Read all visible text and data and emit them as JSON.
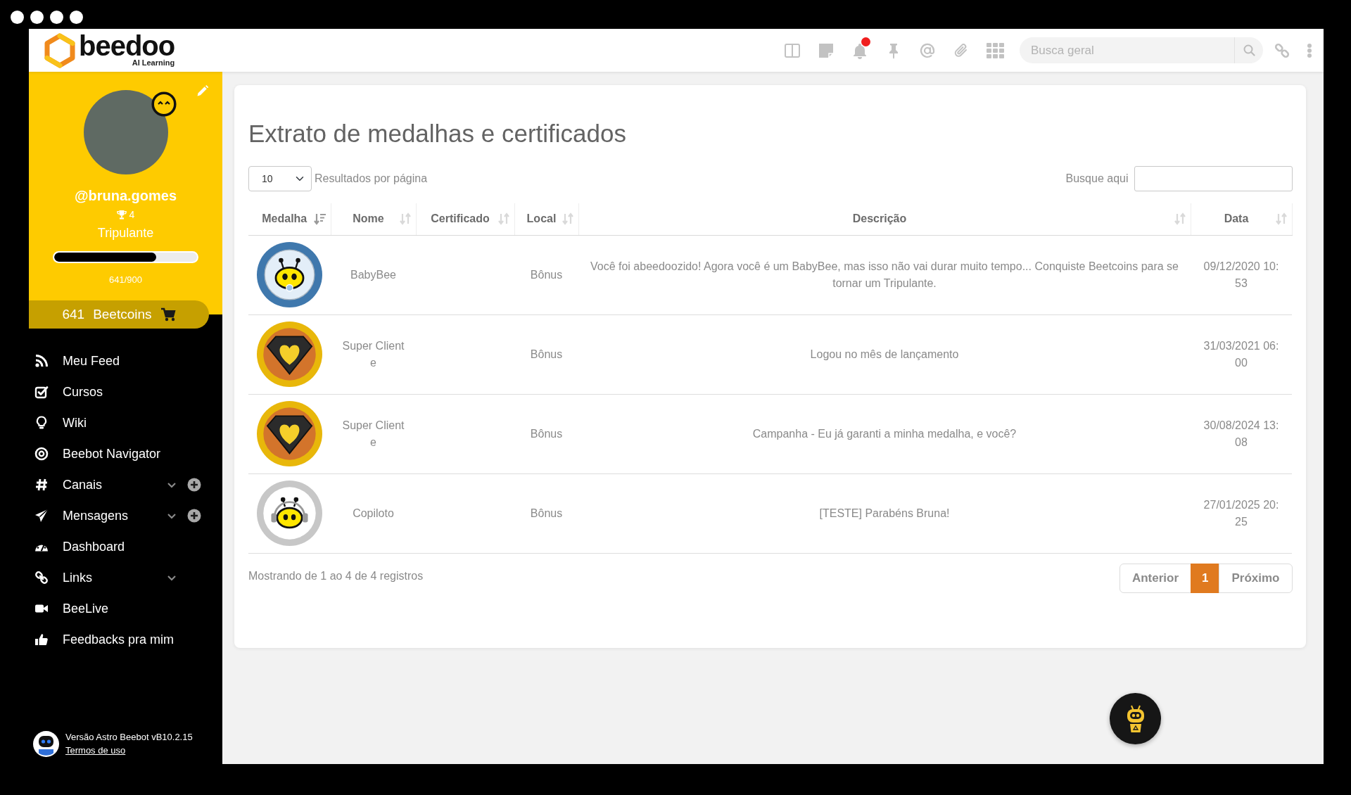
{
  "logo": {
    "name": "beedoo",
    "tagline": "AI Learning"
  },
  "top_bar": {
    "notifications_unread": true,
    "search": {
      "placeholder": "Busca geral"
    }
  },
  "profile": {
    "username": "@bruna.gomes",
    "trophies": "4",
    "rank": "Tripulante",
    "progress": {
      "level": 0.712,
      "reading": "641/900"
    },
    "beetcoins": {
      "amount": "641",
      "label": "Beetcoins"
    }
  },
  "menu": {
    "items": [
      {
        "kind": "link",
        "label": "Meu Feed"
      },
      {
        "kind": "link",
        "label": "Cursos"
      },
      {
        "kind": "link",
        "label": "Wiki"
      },
      {
        "kind": "link",
        "label": "Beebot Navigator"
      },
      {
        "kind": "group",
        "label": "Canais",
        "expanded": false,
        "add": true
      },
      {
        "kind": "group",
        "label": "Mensagens",
        "expanded": false,
        "add": true
      },
      {
        "kind": "link",
        "label": "Dashboard"
      },
      {
        "kind": "group",
        "label": "Links",
        "expanded": false,
        "add": false
      },
      {
        "kind": "link",
        "label": "BeeLive"
      },
      {
        "kind": "link",
        "label": "Feedbacks pra mim"
      }
    ]
  },
  "sidebar_footer": {
    "version": "Versão Astro Beebot vB10.2.15",
    "terms_link": "Termos de uso"
  },
  "page": {
    "title": "Extrato de medalhas e certificados",
    "page_size": {
      "value": "10",
      "label": "Resultados por página"
    },
    "search": {
      "label": "Busque aqui"
    },
    "table": {
      "columns": [
        {
          "label": "Medalha",
          "sorted": true
        },
        {
          "label": "Nome",
          "sorted": false
        },
        {
          "label": "Certificado",
          "sorted": false
        },
        {
          "label": "Local",
          "sorted": false
        },
        {
          "label": "Descrição",
          "sorted": false
        },
        {
          "label": "Data",
          "sorted": false
        }
      ],
      "rows": [
        {
          "kind": "bee",
          "name": "BabyBee",
          "local": "Bônus",
          "description": "Você foi abeedoozido! Agora você é um BabyBee, mas isso não vai durar muito tempo... Conquiste Beetcoins para se tornar um Tripulante.",
          "date": "09/12/2020 10:53"
        },
        {
          "kind": "heart",
          "name": "Super Cliente",
          "local": "Bônus",
          "description": "Logou no mês de lançamento",
          "date": "31/03/2021 06:00"
        },
        {
          "kind": "heart",
          "name": "Super Cliente",
          "local": "Bônus",
          "description": "Campanha - Eu já garanti a minha medalha, e você?",
          "date": "30/08/2024 13:08"
        },
        {
          "kind": "headset",
          "name": "Copiloto",
          "local": "Bônus",
          "description": "[TESTE] Parabéns Bruna!",
          "date": "27/01/2025 20:25"
        }
      ]
    },
    "summary": "Mostrando de 1 ao 4 de 4 registros",
    "pagination": {
      "previous": "Anterior",
      "pages": [
        {
          "label": "1",
          "selected": true
        }
      ],
      "next": "Próximo"
    }
  }
}
